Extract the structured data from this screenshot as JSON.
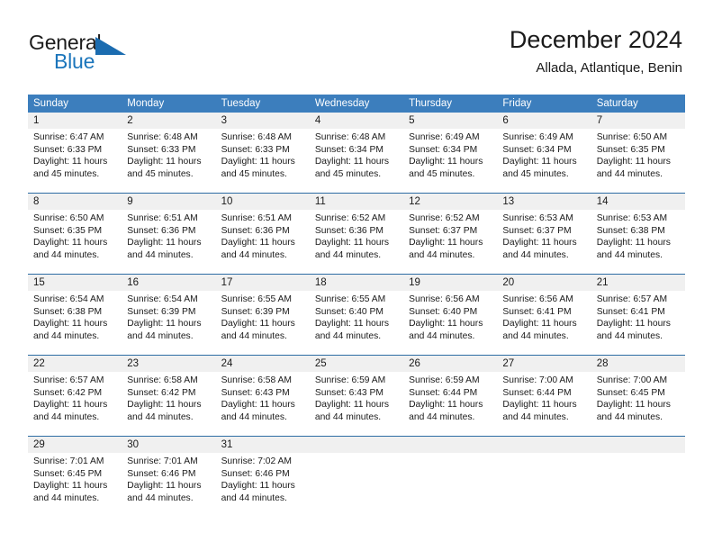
{
  "brand": {
    "name_part1": "General",
    "name_part2": "Blue",
    "logo_icon": "triangle-logo-icon"
  },
  "header": {
    "title": "December 2024",
    "subtitle": "Allada, Atlantique, Benin"
  },
  "colors": {
    "header_blue": "#3c7ebd",
    "row_divider_blue": "#2e6da4",
    "daynum_band": "#f0f0f0",
    "brand_blue": "#1b75bb",
    "text": "#1a1a1a"
  },
  "weekday_headers": [
    "Sunday",
    "Monday",
    "Tuesday",
    "Wednesday",
    "Thursday",
    "Friday",
    "Saturday"
  ],
  "weeks": [
    [
      {
        "day": "1",
        "sunrise": "Sunrise: 6:47 AM",
        "sunset": "Sunset: 6:33 PM",
        "daylight_1": "Daylight: 11 hours",
        "daylight_2": "and 45 minutes."
      },
      {
        "day": "2",
        "sunrise": "Sunrise: 6:48 AM",
        "sunset": "Sunset: 6:33 PM",
        "daylight_1": "Daylight: 11 hours",
        "daylight_2": "and 45 minutes."
      },
      {
        "day": "3",
        "sunrise": "Sunrise: 6:48 AM",
        "sunset": "Sunset: 6:33 PM",
        "daylight_1": "Daylight: 11 hours",
        "daylight_2": "and 45 minutes."
      },
      {
        "day": "4",
        "sunrise": "Sunrise: 6:48 AM",
        "sunset": "Sunset: 6:34 PM",
        "daylight_1": "Daylight: 11 hours",
        "daylight_2": "and 45 minutes."
      },
      {
        "day": "5",
        "sunrise": "Sunrise: 6:49 AM",
        "sunset": "Sunset: 6:34 PM",
        "daylight_1": "Daylight: 11 hours",
        "daylight_2": "and 45 minutes."
      },
      {
        "day": "6",
        "sunrise": "Sunrise: 6:49 AM",
        "sunset": "Sunset: 6:34 PM",
        "daylight_1": "Daylight: 11 hours",
        "daylight_2": "and 45 minutes."
      },
      {
        "day": "7",
        "sunrise": "Sunrise: 6:50 AM",
        "sunset": "Sunset: 6:35 PM",
        "daylight_1": "Daylight: 11 hours",
        "daylight_2": "and 44 minutes."
      }
    ],
    [
      {
        "day": "8",
        "sunrise": "Sunrise: 6:50 AM",
        "sunset": "Sunset: 6:35 PM",
        "daylight_1": "Daylight: 11 hours",
        "daylight_2": "and 44 minutes."
      },
      {
        "day": "9",
        "sunrise": "Sunrise: 6:51 AM",
        "sunset": "Sunset: 6:36 PM",
        "daylight_1": "Daylight: 11 hours",
        "daylight_2": "and 44 minutes."
      },
      {
        "day": "10",
        "sunrise": "Sunrise: 6:51 AM",
        "sunset": "Sunset: 6:36 PM",
        "daylight_1": "Daylight: 11 hours",
        "daylight_2": "and 44 minutes."
      },
      {
        "day": "11",
        "sunrise": "Sunrise: 6:52 AM",
        "sunset": "Sunset: 6:36 PM",
        "daylight_1": "Daylight: 11 hours",
        "daylight_2": "and 44 minutes."
      },
      {
        "day": "12",
        "sunrise": "Sunrise: 6:52 AM",
        "sunset": "Sunset: 6:37 PM",
        "daylight_1": "Daylight: 11 hours",
        "daylight_2": "and 44 minutes."
      },
      {
        "day": "13",
        "sunrise": "Sunrise: 6:53 AM",
        "sunset": "Sunset: 6:37 PM",
        "daylight_1": "Daylight: 11 hours",
        "daylight_2": "and 44 minutes."
      },
      {
        "day": "14",
        "sunrise": "Sunrise: 6:53 AM",
        "sunset": "Sunset: 6:38 PM",
        "daylight_1": "Daylight: 11 hours",
        "daylight_2": "and 44 minutes."
      }
    ],
    [
      {
        "day": "15",
        "sunrise": "Sunrise: 6:54 AM",
        "sunset": "Sunset: 6:38 PM",
        "daylight_1": "Daylight: 11 hours",
        "daylight_2": "and 44 minutes."
      },
      {
        "day": "16",
        "sunrise": "Sunrise: 6:54 AM",
        "sunset": "Sunset: 6:39 PM",
        "daylight_1": "Daylight: 11 hours",
        "daylight_2": "and 44 minutes."
      },
      {
        "day": "17",
        "sunrise": "Sunrise: 6:55 AM",
        "sunset": "Sunset: 6:39 PM",
        "daylight_1": "Daylight: 11 hours",
        "daylight_2": "and 44 minutes."
      },
      {
        "day": "18",
        "sunrise": "Sunrise: 6:55 AM",
        "sunset": "Sunset: 6:40 PM",
        "daylight_1": "Daylight: 11 hours",
        "daylight_2": "and 44 minutes."
      },
      {
        "day": "19",
        "sunrise": "Sunrise: 6:56 AM",
        "sunset": "Sunset: 6:40 PM",
        "daylight_1": "Daylight: 11 hours",
        "daylight_2": "and 44 minutes."
      },
      {
        "day": "20",
        "sunrise": "Sunrise: 6:56 AM",
        "sunset": "Sunset: 6:41 PM",
        "daylight_1": "Daylight: 11 hours",
        "daylight_2": "and 44 minutes."
      },
      {
        "day": "21",
        "sunrise": "Sunrise: 6:57 AM",
        "sunset": "Sunset: 6:41 PM",
        "daylight_1": "Daylight: 11 hours",
        "daylight_2": "and 44 minutes."
      }
    ],
    [
      {
        "day": "22",
        "sunrise": "Sunrise: 6:57 AM",
        "sunset": "Sunset: 6:42 PM",
        "daylight_1": "Daylight: 11 hours",
        "daylight_2": "and 44 minutes."
      },
      {
        "day": "23",
        "sunrise": "Sunrise: 6:58 AM",
        "sunset": "Sunset: 6:42 PM",
        "daylight_1": "Daylight: 11 hours",
        "daylight_2": "and 44 minutes."
      },
      {
        "day": "24",
        "sunrise": "Sunrise: 6:58 AM",
        "sunset": "Sunset: 6:43 PM",
        "daylight_1": "Daylight: 11 hours",
        "daylight_2": "and 44 minutes."
      },
      {
        "day": "25",
        "sunrise": "Sunrise: 6:59 AM",
        "sunset": "Sunset: 6:43 PM",
        "daylight_1": "Daylight: 11 hours",
        "daylight_2": "and 44 minutes."
      },
      {
        "day": "26",
        "sunrise": "Sunrise: 6:59 AM",
        "sunset": "Sunset: 6:44 PM",
        "daylight_1": "Daylight: 11 hours",
        "daylight_2": "and 44 minutes."
      },
      {
        "day": "27",
        "sunrise": "Sunrise: 7:00 AM",
        "sunset": "Sunset: 6:44 PM",
        "daylight_1": "Daylight: 11 hours",
        "daylight_2": "and 44 minutes."
      },
      {
        "day": "28",
        "sunrise": "Sunrise: 7:00 AM",
        "sunset": "Sunset: 6:45 PM",
        "daylight_1": "Daylight: 11 hours",
        "daylight_2": "and 44 minutes."
      }
    ],
    [
      {
        "day": "29",
        "sunrise": "Sunrise: 7:01 AM",
        "sunset": "Sunset: 6:45 PM",
        "daylight_1": "Daylight: 11 hours",
        "daylight_2": "and 44 minutes."
      },
      {
        "day": "30",
        "sunrise": "Sunrise: 7:01 AM",
        "sunset": "Sunset: 6:46 PM",
        "daylight_1": "Daylight: 11 hours",
        "daylight_2": "and 44 minutes."
      },
      {
        "day": "31",
        "sunrise": "Sunrise: 7:02 AM",
        "sunset": "Sunset: 6:46 PM",
        "daylight_1": "Daylight: 11 hours",
        "daylight_2": "and 44 minutes."
      },
      {
        "day": "",
        "sunrise": "",
        "sunset": "",
        "daylight_1": "",
        "daylight_2": ""
      },
      {
        "day": "",
        "sunrise": "",
        "sunset": "",
        "daylight_1": "",
        "daylight_2": ""
      },
      {
        "day": "",
        "sunrise": "",
        "sunset": "",
        "daylight_1": "",
        "daylight_2": ""
      },
      {
        "day": "",
        "sunrise": "",
        "sunset": "",
        "daylight_1": "",
        "daylight_2": ""
      }
    ]
  ]
}
